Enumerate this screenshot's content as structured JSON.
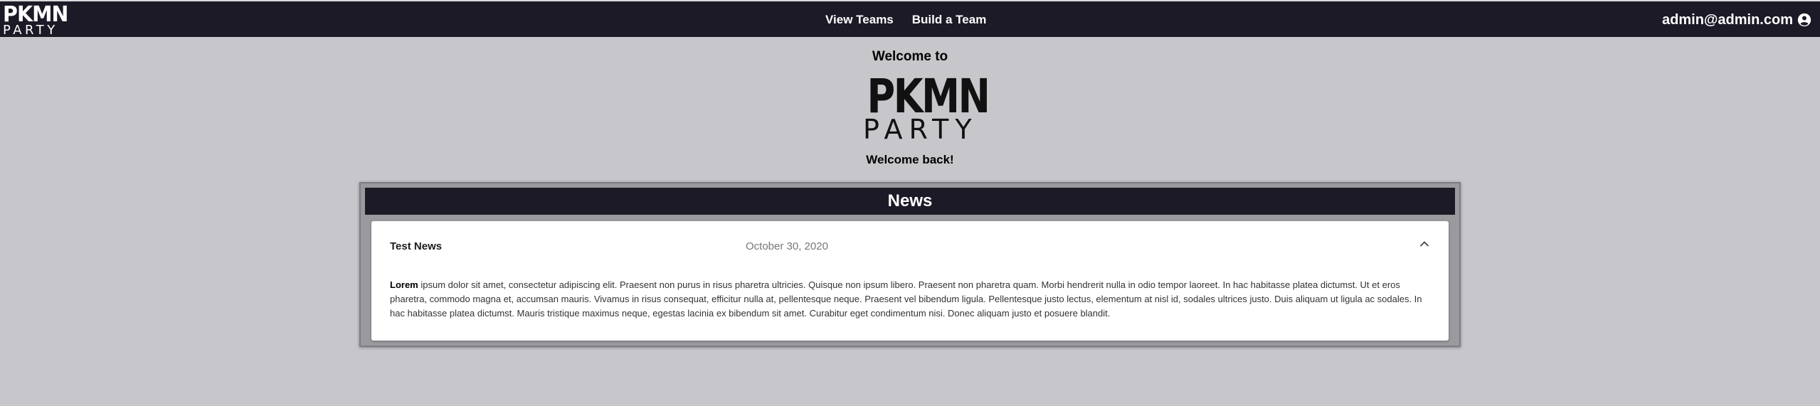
{
  "navbar": {
    "logo_top": "PKMN",
    "logo_bottom": "PARTY",
    "links": [
      {
        "label": "View Teams"
      },
      {
        "label": "Build a Team"
      }
    ],
    "user_email": "admin@admin.com",
    "user_icon": "account-circle-icon",
    "background_color": "#1b1a26"
  },
  "hero": {
    "welcome_to": "Welcome to",
    "logo_top": "PKMN",
    "logo_bottom": "PARTY",
    "welcome_back": "Welcome back!"
  },
  "news": {
    "header": "News",
    "items": [
      {
        "title": "Test News",
        "date": "October 30, 2020",
        "expanded": true,
        "toggle_icon": "chevron-up-icon",
        "body_lead": "Lorem",
        "body_rest": " ipsum dolor sit amet, consectetur adipiscing elit. Praesent non purus in risus pharetra ultricies. Quisque non ipsum libero. Praesent non pharetra quam. Morbi hendrerit nulla in odio tempor laoreet. In hac habitasse platea dictumst. Ut et eros pharetra, commodo magna et, accumsan mauris. Vivamus in risus consequat, efficitur nulla at, pellentesque neque. Praesent vel bibendum ligula. Pellentesque justo lectus, elementum at nisl id, sodales ultrices justo. Duis aliquam ut ligula ac sodales. In hac habitasse platea dictumst. Mauris tristique maximus neque, egestas lacinia ex bibendum sit amet. Curabitur eget condimentum nisi. Donec aliquam justo et posuere blandit."
      }
    ]
  },
  "colors": {
    "page_background": "#c7c6cb",
    "accent_dark": "#1b1a26"
  }
}
